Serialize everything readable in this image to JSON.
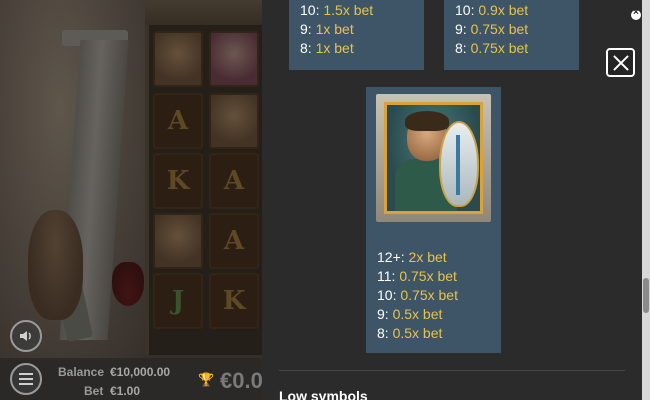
{
  "balance": {
    "label": "Balance",
    "value": "€10,000.00"
  },
  "bet": {
    "label": "Bet",
    "value": "€1.00"
  },
  "win_display": "€0.0",
  "paytable": {
    "card_left": [
      {
        "count": "10:",
        "payout": "1.5x bet"
      },
      {
        "count": "9:",
        "payout": "1x bet"
      },
      {
        "count": "8:",
        "payout": "1x bet"
      }
    ],
    "card_right": [
      {
        "count": "10:",
        "payout": "0.9x bet"
      },
      {
        "count": "9:",
        "payout": "0.75x bet"
      },
      {
        "count": "8:",
        "payout": "0.75x bet"
      }
    ],
    "card_main": [
      {
        "count": "12+:",
        "payout": "2x bet"
      },
      {
        "count": "11:",
        "payout": "0.75x bet"
      },
      {
        "count": "10:",
        "payout": "0.75x bet"
      },
      {
        "count": "9:",
        "payout": "0.5x bet"
      },
      {
        "count": "8:",
        "payout": "0.5x bet"
      }
    ],
    "section_title": "Low symbols"
  },
  "reel_letters": [
    "A",
    "K",
    "A",
    "A",
    "J",
    "K"
  ],
  "icons": {
    "sound": "speaker-icon",
    "menu": "hamburger-icon",
    "close": "close-icon",
    "trophy": "trophy-icon"
  },
  "colors": {
    "card_bg": "#3e5568",
    "multiplier": "#e8c34a",
    "panel_bg": "#2b2b2b"
  }
}
